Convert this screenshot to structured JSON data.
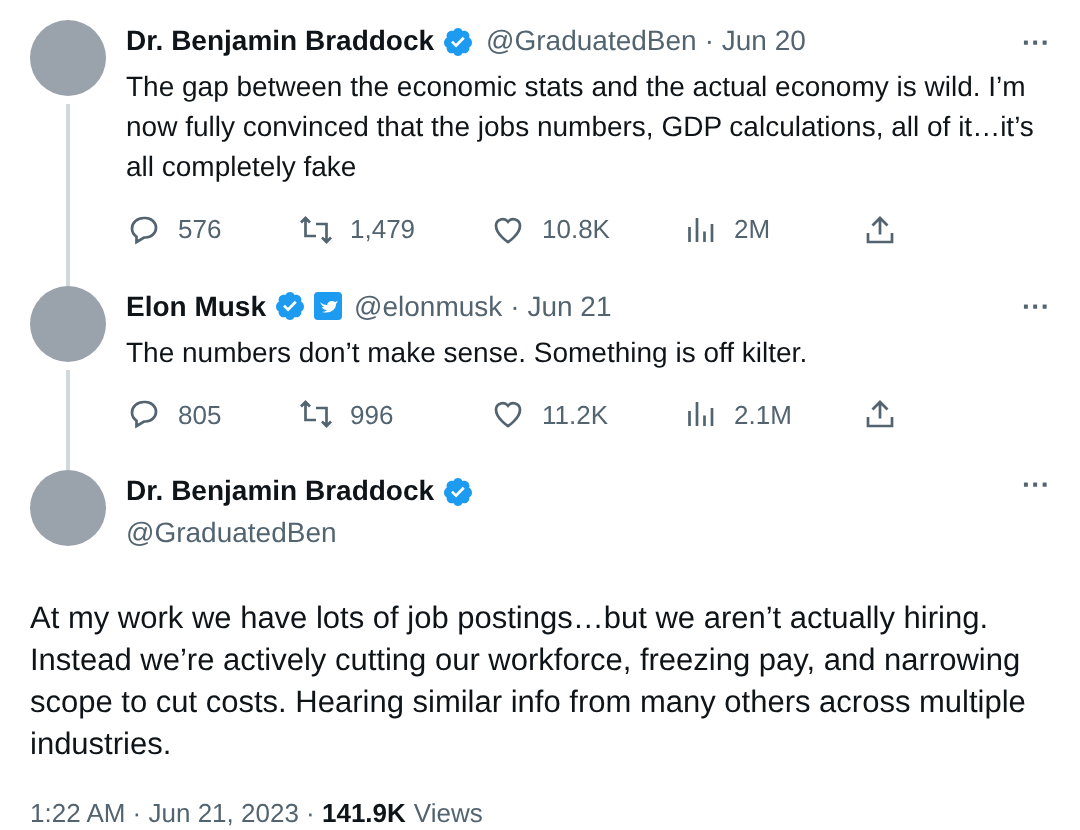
{
  "thread": [
    {
      "name": "Dr. Benjamin Braddock",
      "verified": true,
      "affiliate_badge": false,
      "handle": "@GraduatedBen",
      "date": "· Jun 20",
      "more": "···",
      "text": "The gap between the economic stats and the actual economy is wild. I’m now fully convinced that the jobs numbers, GDP calculations, all of it…it’s all completely fake",
      "stats": {
        "replies": "576",
        "reposts": "1,479",
        "likes": "10.8K",
        "views": "2M"
      }
    },
    {
      "name": "Elon Musk",
      "verified": true,
      "affiliate_badge": true,
      "handle": "@elonmusk",
      "date": "· Jun 21",
      "more": "···",
      "text": "The numbers don’t make sense. Something is off kilter.",
      "stats": {
        "replies": "805",
        "reposts": "996",
        "likes": "11.2K",
        "views": "2.1M"
      }
    }
  ],
  "main_tweet": {
    "name": "Dr. Benjamin Braddock",
    "verified": true,
    "handle": "@GraduatedBen",
    "more": "···",
    "text": "At my work we have lots of job postings…but we aren’t actually hiring. Instead we’re actively cutting our workforce, freezing pay, and narrowing scope to cut costs. Hearing similar info from many others across multiple industries.",
    "time": "1:22 AM · Jun 21, 2023 · ",
    "views_count": "141.9K",
    "views_label": "Views"
  }
}
